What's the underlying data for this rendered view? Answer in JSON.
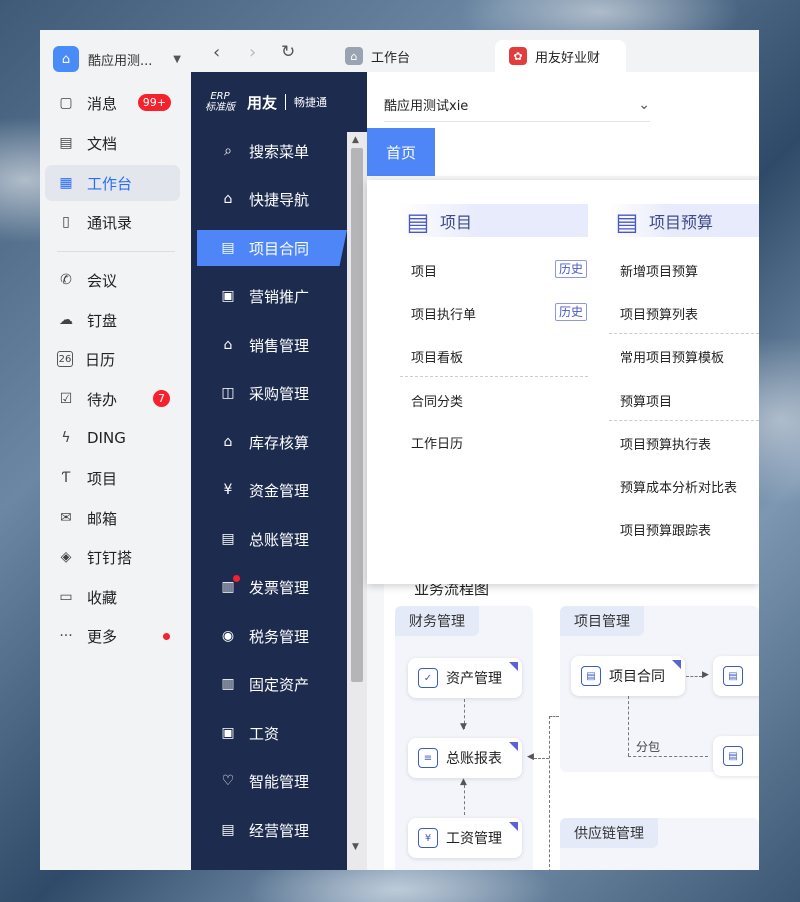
{
  "sidebar": {
    "org_name": "酷应用测...",
    "items": [
      {
        "label": "消息",
        "icon": "message-icon",
        "badge": "99+"
      },
      {
        "label": "文档",
        "icon": "document-icon"
      },
      {
        "label": "工作台",
        "icon": "workbench-icon",
        "active": true
      },
      {
        "label": "通讯录",
        "icon": "contacts-icon"
      },
      {
        "label": "会议",
        "icon": "phone-icon"
      },
      {
        "label": "钉盘",
        "icon": "cloud-icon"
      },
      {
        "label": "日历",
        "icon": "calendar-icon"
      },
      {
        "label": "待办",
        "icon": "todo-icon",
        "badge": "7"
      },
      {
        "label": "DING",
        "icon": "ding-icon"
      },
      {
        "label": "项目",
        "icon": "project-icon"
      },
      {
        "label": "邮箱",
        "icon": "mail-icon"
      },
      {
        "label": "钉钉搭",
        "icon": "builder-icon"
      },
      {
        "label": "收藏",
        "icon": "favorite-icon"
      },
      {
        "label": "更多",
        "icon": "more-icon",
        "dot": true
      }
    ]
  },
  "tabs": [
    {
      "label": "工作台"
    },
    {
      "label": "用友好业财",
      "active": true
    }
  ],
  "app": {
    "logo": {
      "erp": "ERP",
      "edition": "标准版",
      "brand": "用友",
      "sub": "畅捷通"
    },
    "company": "酷应用测试xie",
    "home_tab": "首页",
    "menu": [
      "搜索菜单",
      "快捷导航",
      "项目合同",
      "营销推广",
      "销售管理",
      "采购管理",
      "库存核算",
      "资金管理",
      "总账管理",
      "发票管理",
      "税务管理",
      "固定资产",
      "工资",
      "智能管理",
      "经营管理"
    ],
    "menu_active": "项目合同",
    "dropdown": {
      "col1": {
        "title": "项目",
        "items": [
          "项目",
          "项目执行单",
          "项目看板",
          "合同分类",
          "工作日历"
        ],
        "history_label": "历史"
      },
      "col2": {
        "title": "项目预算",
        "items": [
          "新增项目预算",
          "项目预算列表",
          "常用项目预算模板",
          "预算项目",
          "项目预算执行表",
          "预算成本分析对比表",
          "项目预算跟踪表"
        ]
      }
    },
    "flow": {
      "title": "业务流程图",
      "groups": {
        "finance": "财务管理",
        "project": "项目管理",
        "supply": "供应链管理"
      },
      "nodes": {
        "asset": "资产管理",
        "ledger": "总账报表",
        "salary": "工资管理",
        "contract": "项目合同"
      },
      "subcontract": "分包"
    }
  },
  "colors": {
    "accent": "#4e86f7",
    "dark_menu": "#1d2b4f",
    "badge": "#f5222d"
  }
}
